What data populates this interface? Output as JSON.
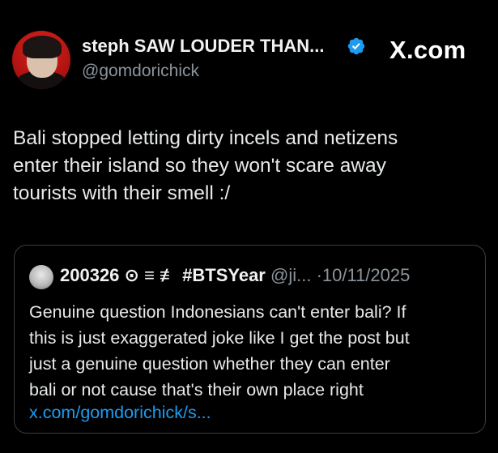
{
  "brand": {
    "label": "X.com"
  },
  "tweet": {
    "author": {
      "display_name": "steph SAW LOUDER THAN...",
      "handle": "@gomdorichick",
      "verified": true,
      "avatar_icon": "profile-photo-avatar"
    },
    "text": "Bali stopped letting dirty incels and netizens\nenter their island so they won't scare away\ntourists with their smell :/"
  },
  "quoted_tweet": {
    "display_name": "200326 ⊙ ≡ ≢ #BTSYear",
    "handle": "@ji...",
    "separator": "·",
    "date": "10/11/2025",
    "text": "Genuine question Indonesians can't enter bali? If\nthis is just exaggerated joke like I get the post but\njust a genuine question whether they can enter\nbali or not cause that's their own place right",
    "link_text": "x.com/gomdorichick/s..."
  },
  "colors": {
    "background": "#000000",
    "text": "#e7e9ea",
    "secondary_text": "#8b949b",
    "link": "#1d9bf0",
    "verified_badge": "#1d9bf0",
    "card_border": "#3a3d41"
  }
}
